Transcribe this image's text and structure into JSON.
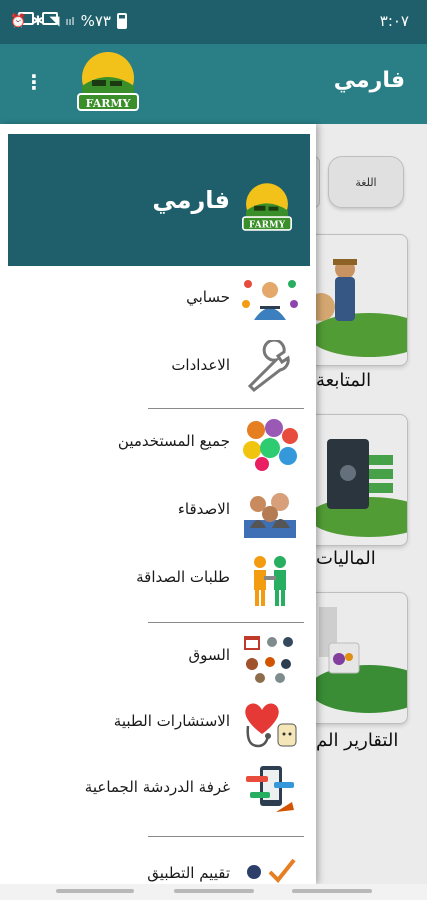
{
  "status_bar": {
    "time": "٣:٠٧",
    "battery": "%٧٣"
  },
  "app": {
    "title": "فارمي",
    "logo_text": "FARMY",
    "menu_icon": "more-vert-icon"
  },
  "main": {
    "language_button": "اللغة",
    "cards": [
      {
        "label": "المتابعة",
        "icon": "farmer-icon"
      },
      {
        "label": "الماليات",
        "icon": "money-safe-icon"
      },
      {
        "label": "التقارير الم",
        "icon": "reports-icon"
      }
    ]
  },
  "drawer": {
    "header": {
      "name": "فارمي",
      "logo_text": "FARMY"
    },
    "groups": [
      [
        {
          "label": "حسابي",
          "icon": "account-icon"
        },
        {
          "label": "الاعدادات",
          "icon": "wrench-icon"
        }
      ],
      [
        {
          "label": "جميع المستخدمين",
          "icon": "all-users-icon"
        },
        {
          "label": "الاصدقاء",
          "icon": "friends-icon"
        },
        {
          "label": "طلبات الصداقة",
          "icon": "friend-requests-icon"
        }
      ],
      [
        {
          "label": "السوق",
          "icon": "market-icon"
        },
        {
          "label": "الاستشارات الطبية",
          "icon": "medical-icon"
        },
        {
          "label": "غرفة الدردشة الجماعية",
          "icon": "group-chat-icon"
        }
      ],
      [
        {
          "label": "تقييم التطبيق",
          "icon": "rate-icon"
        }
      ]
    ]
  },
  "colors": {
    "primary_dark": "#1e5f6b",
    "primary": "#2a7f87",
    "logo_green": "#3a8f2a",
    "logo_yellow": "#f2c21b"
  }
}
